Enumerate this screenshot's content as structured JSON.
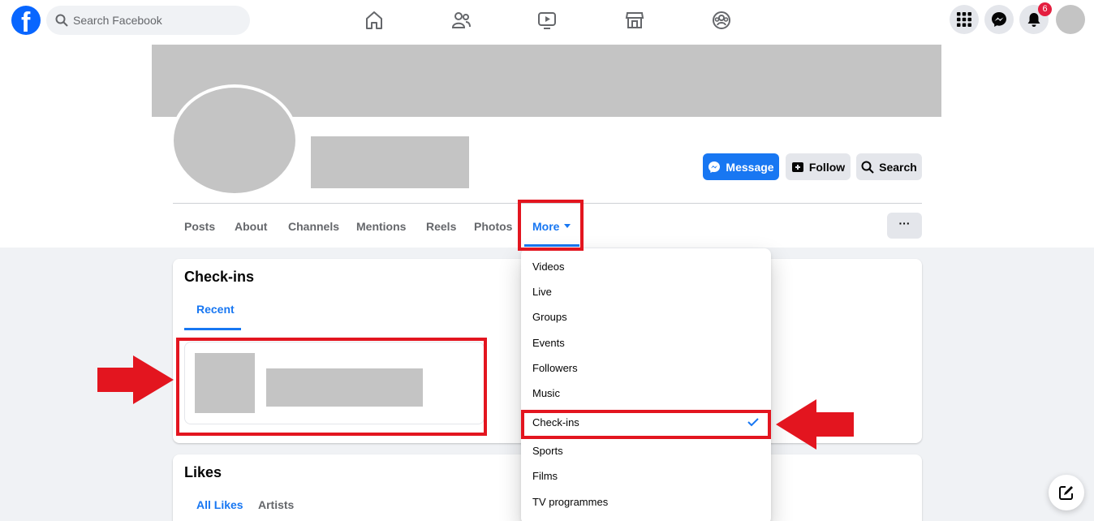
{
  "topbar": {
    "logo_letter": "f",
    "search_placeholder": "Search Facebook",
    "notification_count": "6"
  },
  "profile": {
    "buttons": {
      "message": "Message",
      "follow": "Follow",
      "search": "Search"
    },
    "tabs": [
      "Posts",
      "About",
      "Channels",
      "Mentions",
      "Reels",
      "Photos",
      "More"
    ],
    "more_menu_button": "···"
  },
  "checkins_card": {
    "title": "Check-ins",
    "subtab_active": "Recent"
  },
  "likes_card": {
    "title": "Likes",
    "subtab_active": "All Likes",
    "subtab_other": "Artists"
  },
  "dropdown": {
    "items": [
      "Videos",
      "Live",
      "Groups",
      "Events",
      "Followers",
      "Music",
      "Check-ins",
      "Sports",
      "Films",
      "TV programmes"
    ],
    "selected": "Check-ins"
  },
  "colors": {
    "brand_blue": "#1877f2",
    "highlight_red": "#e3151f",
    "placeholder_gray": "#c4c4c4"
  }
}
